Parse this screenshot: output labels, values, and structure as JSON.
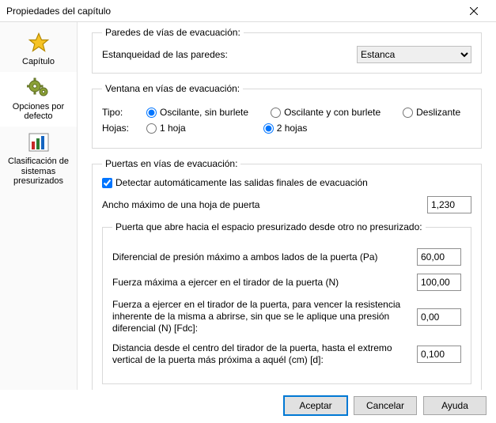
{
  "window": {
    "title": "Propiedades del capítulo"
  },
  "sidebar": {
    "items": [
      {
        "label": "Capítulo",
        "icon": "star"
      },
      {
        "label": "Opciones por defecto",
        "icon": "gears"
      },
      {
        "label": "Clasificación de sistemas presurizados",
        "icon": "chart"
      }
    ]
  },
  "sections": {
    "paredes": {
      "legend": "Paredes de vías de evacuación:",
      "estanqueidad_label": "Estanqueidad de las paredes:",
      "estanqueidad_value": "Estanca"
    },
    "ventana": {
      "legend": "Ventana en vías de evacuación:",
      "tipo_label": "Tipo:",
      "tipo_options": {
        "osc_sin_burlete": "Oscilante, sin burlete",
        "osc_con_burlete": "Oscilante y con burlete",
        "deslizante": "Deslizante"
      },
      "hojas_label": "Hojas:",
      "hojas_options": {
        "una": "1 hoja",
        "dos": "2 hojas"
      }
    },
    "puertas": {
      "legend": "Puertas en vías de evacuación:",
      "detectar_label": "Detectar automáticamente las salidas finales de evacuación",
      "ancho_label": "Ancho máximo de una hoja de puerta",
      "ancho_value": "1,230",
      "sub_legend": "Puerta que abre hacia el espacio presurizado desde otro no presurizado:",
      "diferencial_label": "Diferencial de presión máximo a ambos lados de la puerta (Pa)",
      "diferencial_value": "60,00",
      "fuerza_max_label": "Fuerza máxima a ejercer en el tirador de la puerta  (N)",
      "fuerza_max_value": "100,00",
      "fuerza_fdc_label": "Fuerza a ejercer en el tirador de la puerta, para vencer la resistencia inherente de la misma a abrirse, sin que se le aplique una presión diferencial (N) [Fdc]:",
      "fuerza_fdc_value": "0,00",
      "distancia_label": "Distancia desde el centro del tirador de la puerta, hasta el extremo vertical de la puerta más próxima a aquél (cm) [d]:",
      "distancia_value": "0,100"
    }
  },
  "buttons": {
    "accept": "Aceptar",
    "cancel": "Cancelar",
    "help": "Ayuda"
  }
}
